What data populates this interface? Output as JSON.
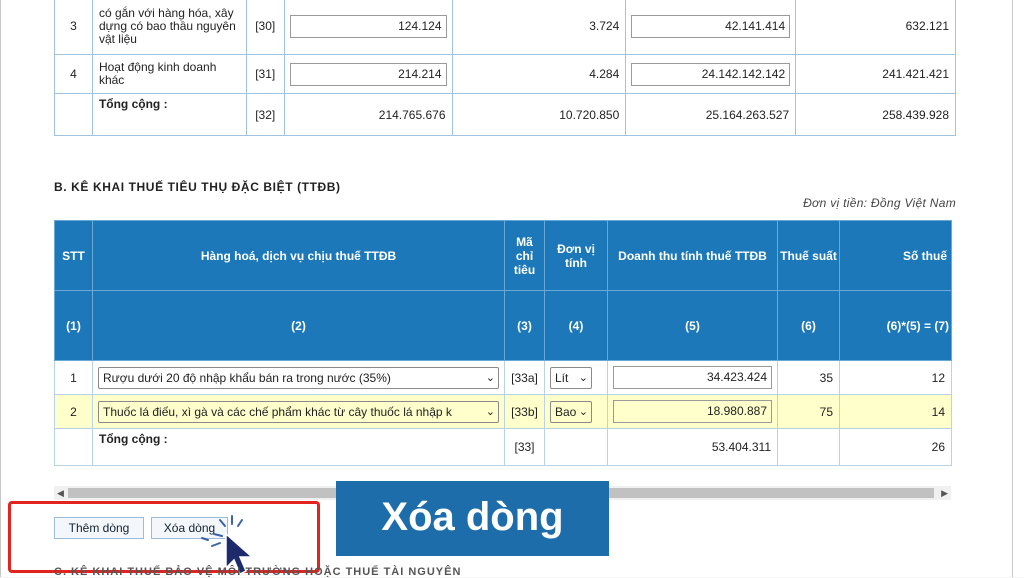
{
  "top_table": {
    "rows": [
      {
        "stt": "3",
        "desc": "có gắn với hàng hóa, xây dựng có bao thầu nguyên vật liệu",
        "code": "[30]",
        "v1": "124.124",
        "v2": "3.724",
        "v3": "42.141.414",
        "v4": "632.121"
      },
      {
        "stt": "4",
        "desc": "Hoạt động kinh doanh khác",
        "code": "[31]",
        "v1": "214.214",
        "v2": "4.284",
        "v3": "24.142.142.142",
        "v4": "241.421.421"
      }
    ],
    "total": {
      "label": "Tổng cộng :",
      "code": "[32]",
      "v1": "214.765.676",
      "v2": "10.720.850",
      "v3": "25.164.263.527",
      "v4": "258.439.928"
    }
  },
  "section_b": {
    "title": "B. KÊ KHAI THUẾ TIÊU THỤ ĐẶC BIỆT (TTĐB)",
    "unit": "Đơn vị tiền: Đồng Việt Nam",
    "headers": {
      "stt": "STT",
      "goods": "Hàng hoá, dịch vụ chịu thuế TTĐB",
      "code": "Mã chỉ tiêu",
      "unit": "Đơn vị tính",
      "revenue": "Doanh thu tính thuế TTĐB",
      "rate": "Thuế suất",
      "tax": "Số thuế"
    },
    "header_nums": {
      "c1": "(1)",
      "c2": "(2)",
      "c3": "(3)",
      "c4": "(4)",
      "c5": "(5)",
      "c6": "(6)",
      "c7": "(7) = (5)*(6)"
    },
    "rows": [
      {
        "stt": "1",
        "goods": "Rượu dưới 20 độ nhập khẩu bán ra trong nước (35%)",
        "code": "[33a]",
        "unit": "Lít",
        "revenue": "34.423.424",
        "rate": "35",
        "tax": "12"
      },
      {
        "stt": "2",
        "goods": "Thuốc lá điếu, xì gà và các chế phẩm khác từ cây thuốc lá nhập k",
        "code": "[33b]",
        "unit": "Bao",
        "revenue": "18.980.887",
        "rate": "75",
        "tax": "14"
      }
    ],
    "total": {
      "label": "Tổng cộng :",
      "code": "[33]",
      "revenue": "53.404.311",
      "tax": "26"
    }
  },
  "buttons": {
    "add": "Thêm dòng",
    "delete": "Xóa dòng"
  },
  "banner": "Xóa dòng",
  "bottom_text": "C. KÊ KHAI THUẾ BẢO VỆ MÔI TRƯỜNG HOẶC THUẾ TÀI NGUYÊN",
  "colors": {
    "header": "#1c78b8",
    "highlight": "#ffffcc",
    "banner": "#1c6da9",
    "redbox": "#e2241e"
  }
}
